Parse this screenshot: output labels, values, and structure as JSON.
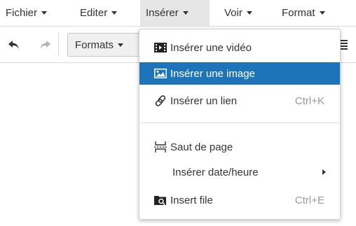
{
  "menubar": {
    "items": [
      {
        "label": "Fichier"
      },
      {
        "label": "Editer"
      },
      {
        "label": "Insérer"
      },
      {
        "label": "Voir"
      },
      {
        "label": "Format"
      }
    ]
  },
  "toolbar": {
    "undo_icon": "undo-icon",
    "redo_icon": "redo-icon",
    "formats_label": "Formats",
    "align_icon": "align-justify-icon"
  },
  "dropdown": {
    "items": [
      {
        "label": "Insérer une vidéo",
        "icon": "video-icon",
        "shortcut": ""
      },
      {
        "label": "Insérer une image",
        "icon": "image-icon",
        "shortcut": ""
      },
      {
        "label": "Insérer un lien",
        "icon": "link-icon",
        "shortcut": "Ctrl+K"
      },
      {
        "label": "Saut de page",
        "icon": "page-break-icon",
        "shortcut": ""
      },
      {
        "label": "Insérer date/heure",
        "icon": "",
        "shortcut": ""
      },
      {
        "label": "Insert file",
        "icon": "folder-search-icon",
        "shortcut": "Ctrl+E"
      }
    ]
  },
  "colors": {
    "selected_background": "#1e74b8",
    "active_menu_background": "#e6e6e6"
  }
}
